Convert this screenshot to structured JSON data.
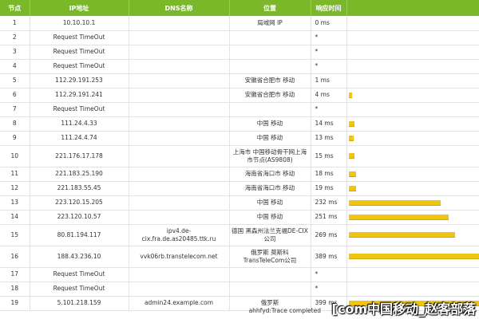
{
  "header": {
    "hop": "节点",
    "ip": "IP地址",
    "dns": "DNS名称",
    "location": "位置",
    "time": "响应时间",
    "bar": ""
  },
  "rows": [
    {
      "hop": "1",
      "ip": "10.10.10.1",
      "dns": "",
      "location": "局域网 IP",
      "time": "0 ms",
      "ms": 0
    },
    {
      "hop": "2",
      "ip": "Request TimeOut",
      "dns": "",
      "location": "",
      "time": "*",
      "ms": 0
    },
    {
      "hop": "3",
      "ip": "Request TimeOut",
      "dns": "",
      "location": "",
      "time": "*",
      "ms": 0
    },
    {
      "hop": "4",
      "ip": "Request TimeOut",
      "dns": "",
      "location": "",
      "time": "*",
      "ms": 0
    },
    {
      "hop": "5",
      "ip": "112.29.191.253",
      "dns": "",
      "location": "安徽省合肥市 移动",
      "time": "1 ms",
      "ms": 1
    },
    {
      "hop": "6",
      "ip": "112.29.191.241",
      "dns": "",
      "location": "安徽省合肥市 移动",
      "time": "4 ms",
      "ms": 4
    },
    {
      "hop": "7",
      "ip": "Request TimeOut",
      "dns": "",
      "location": "",
      "time": "*",
      "ms": 0
    },
    {
      "hop": "8",
      "ip": "111.24.4.33",
      "dns": "",
      "location": "中国 移动",
      "time": "14 ms",
      "ms": 14
    },
    {
      "hop": "9",
      "ip": "111.24.4.74",
      "dns": "",
      "location": "中国 移动",
      "time": "13 ms",
      "ms": 13
    },
    {
      "hop": "10",
      "ip": "221.176.17.178",
      "dns": "",
      "location": "上海市 中国移动骨干网上海市节点(AS9808)",
      "time": "15 ms",
      "ms": 15
    },
    {
      "hop": "11",
      "ip": "221.183.25.190",
      "dns": "",
      "location": "海南省海口市 移动",
      "time": "18 ms",
      "ms": 18
    },
    {
      "hop": "12",
      "ip": "221.183.55.45",
      "dns": "",
      "location": "海南省海口市 移动",
      "time": "19 ms",
      "ms": 19
    },
    {
      "hop": "13",
      "ip": "223.120.15.205",
      "dns": "",
      "location": "中国 移动",
      "time": "232 ms",
      "ms": 232
    },
    {
      "hop": "14",
      "ip": "223.120.10.57",
      "dns": "",
      "location": "中国 移动",
      "time": "251 ms",
      "ms": 251
    },
    {
      "hop": "15",
      "ip": "80.81.194.117",
      "dns": "ipv4.de-cix.fra.de.as20485.ttk.ru",
      "location": "德国 黑森州法兰克福DE-CIX公司",
      "time": "269 ms",
      "ms": 269
    },
    {
      "hop": "16",
      "ip": "188.43.236.10",
      "dns": "vvk06rb.transtelecom.net",
      "location": "俄罗斯 莫斯科TransTeleCom公司",
      "time": "389 ms",
      "ms": 389
    },
    {
      "hop": "17",
      "ip": "Request TimeOut",
      "dns": "",
      "location": "",
      "time": "*",
      "ms": 0
    },
    {
      "hop": "18",
      "ip": "Request TimeOut",
      "dns": "",
      "location": "",
      "time": "*",
      "ms": 0
    },
    {
      "hop": "19",
      "ip": "5.101.218.159",
      "dns": "admin24.example.com",
      "location": "俄罗斯",
      "time": "399 ms",
      "ms": 399
    }
  ],
  "bar_max_ms": 399,
  "footer": {
    "status": "ahhfyd:Trace completed",
    "watermark": "[com中国移动_赵客部落"
  },
  "colors": {
    "header_bg": "#7ab829",
    "bar": "#f1c40f"
  }
}
